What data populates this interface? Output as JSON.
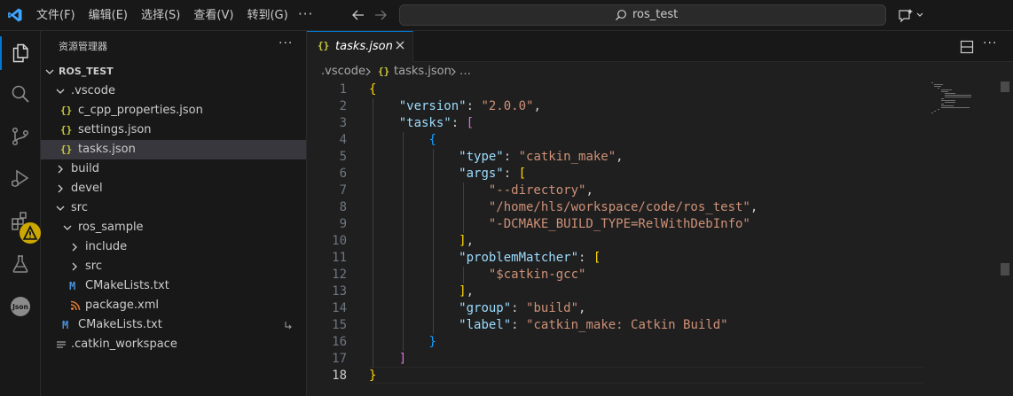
{
  "titlebar": {
    "menu": [
      "文件(F)",
      "编辑(E)",
      "选择(S)",
      "查看(V)",
      "转到(G)"
    ],
    "more": "···",
    "search_text": "ros_test"
  },
  "activity_icons": [
    "explorer-icon",
    "search-icon",
    "source-control-icon",
    "run-debug-icon",
    "extensions-icon",
    "testing-icon",
    "json-icon"
  ],
  "sidebar": {
    "title": "资源管理器",
    "more": "···",
    "root": "ROS_TEST",
    "items": [
      {
        "label": ".vscode",
        "type": "folder-open"
      },
      {
        "label": "c_cpp_properties.json",
        "type": "json"
      },
      {
        "label": "settings.json",
        "type": "json"
      },
      {
        "label": "tasks.json",
        "type": "json"
      },
      {
        "label": "build",
        "type": "folder"
      },
      {
        "label": "devel",
        "type": "folder"
      },
      {
        "label": "src",
        "type": "folder-open"
      },
      {
        "label": "ros_sample",
        "type": "folder-open"
      },
      {
        "label": "include",
        "type": "folder"
      },
      {
        "label": "src",
        "type": "folder"
      },
      {
        "label": "CMakeLists.txt",
        "type": "cmake"
      },
      {
        "label": "package.xml",
        "type": "xml"
      },
      {
        "label": "CMakeLists.txt",
        "type": "cmake"
      },
      {
        "label": ".catkin_workspace",
        "type": "text"
      }
    ],
    "json_icon_glyph": "{}",
    "cmake_icon_glyph": "M"
  },
  "editor": {
    "tab_label": "tasks.json",
    "tab_icon_glyph": "{}",
    "breadcrumb": [
      ".vscode",
      "tasks.json",
      "…"
    ],
    "more": "···",
    "lines": [
      {
        "n": "1",
        "t": "{"
      },
      {
        "n": "2",
        "t": "    \"version\": \"2.0.0\","
      },
      {
        "n": "3",
        "t": "    \"tasks\": ["
      },
      {
        "n": "4",
        "t": "        {"
      },
      {
        "n": "5",
        "t": "            \"type\": \"catkin_make\","
      },
      {
        "n": "6",
        "t": "            \"args\": ["
      },
      {
        "n": "7",
        "t": "                \"--directory\","
      },
      {
        "n": "8",
        "t": "                \"/home/hls/workspace/code/ros_test\","
      },
      {
        "n": "9",
        "t": "                \"-DCMAKE_BUILD_TYPE=RelWithDebInfo\""
      },
      {
        "n": "10",
        "t": "            ],"
      },
      {
        "n": "11",
        "t": "            \"problemMatcher\": ["
      },
      {
        "n": "12",
        "t": "                \"$catkin-gcc\""
      },
      {
        "n": "13",
        "t": "            ],"
      },
      {
        "n": "14",
        "t": "            \"group\": \"build\","
      },
      {
        "n": "15",
        "t": "            \"label\": \"catkin_make: Catkin Build\""
      },
      {
        "n": "16",
        "t": "        }"
      },
      {
        "n": "17",
        "t": "    ]"
      },
      {
        "n": "18",
        "t": "}"
      }
    ]
  },
  "colors": {
    "accent": "#0078d4",
    "json_icon": "#cbcb41",
    "cmake_icon": "#4a8fd9",
    "xml_icon": "#e37933",
    "warning": "#cca700",
    "key": "#9cdcfe",
    "string": "#ce9178",
    "bracket_level1": "#ffd700",
    "bracket_level2": "#da70d6",
    "bracket_level3": "#179fff"
  }
}
